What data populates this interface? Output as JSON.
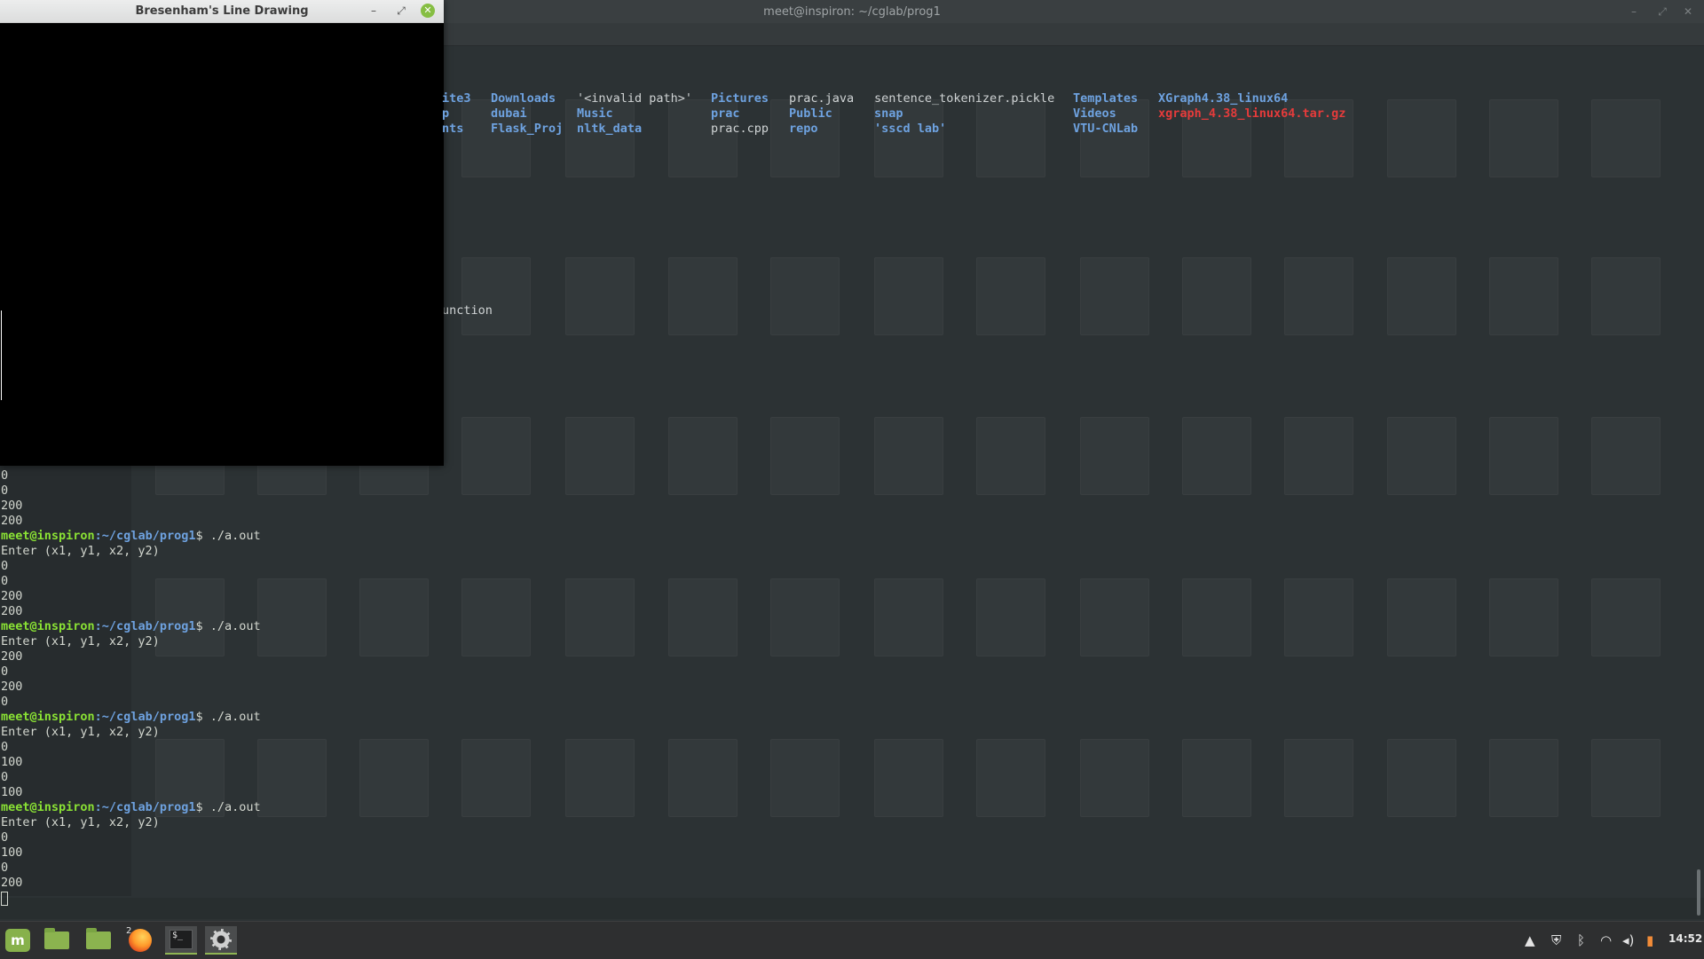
{
  "terminal": {
    "title": "meet@inspiron: ~/cglab/prog1",
    "ls_columns": [
      {
        "col": 1,
        "items": [
          {
            "text": "ite3",
            "kind": "dir"
          },
          {
            "text": "p",
            "kind": "dir"
          },
          {
            "text": "nts",
            "kind": "dir"
          }
        ]
      },
      {
        "col": 2,
        "items": [
          {
            "text": "Downloads",
            "kind": "dir"
          },
          {
            "text": "dubai",
            "kind": "dir"
          },
          {
            "text": "Flask_Proj",
            "kind": "dir"
          }
        ]
      },
      {
        "col": 3,
        "items": [
          {
            "text": "'<invalid path>'",
            "kind": "file"
          },
          {
            "text": "Music",
            "kind": "dir"
          },
          {
            "text": "nltk_data",
            "kind": "dir"
          }
        ]
      },
      {
        "col": 4,
        "items": [
          {
            "text": "Pictures",
            "kind": "dir"
          },
          {
            "text": "prac",
            "kind": "dir"
          },
          {
            "text": "prac.cpp",
            "kind": "file"
          }
        ]
      },
      {
        "col": 5,
        "items": [
          {
            "text": "prac.java",
            "kind": "file"
          },
          {
            "text": "Public",
            "kind": "dir"
          },
          {
            "text": "repo",
            "kind": "dir"
          }
        ]
      },
      {
        "col": 6,
        "items": [
          {
            "text": "sentence_tokenizer.pickle",
            "kind": "file"
          },
          {
            "text": "snap",
            "kind": "dir"
          },
          {
            "text": "'sscd lab'",
            "kind": "dir"
          }
        ]
      },
      {
        "col": 7,
        "items": [
          {
            "text": "Templates",
            "kind": "dir"
          },
          {
            "text": "Videos",
            "kind": "dir"
          },
          {
            "text": "VTU-CNLab",
            "kind": "dir"
          }
        ]
      },
      {
        "col": 8,
        "items": [
          {
            "text": "XGraph4.38_linux64",
            "kind": "dir"
          },
          {
            "text": "xgraph_4.38_linux64.tar.gz",
            "kind": "arch"
          }
        ]
      }
    ],
    "partial_line": "unction",
    "prompt_user": "meet@inspiron",
    "prompt_path": ":~/cglab/prog1",
    "prompt_cmd": "$ ./a.out",
    "enter_prompt": "Enter (x1, y1, x2, y2)",
    "leading_values": [
      "0",
      "0",
      "200",
      "200"
    ],
    "runs": [
      {
        "values": [
          "0",
          "0",
          "200",
          "200"
        ]
      },
      {
        "values": [
          "200",
          "0",
          "200",
          "0"
        ]
      },
      {
        "values": [
          "0",
          "100",
          "0",
          "100"
        ]
      },
      {
        "values": [
          "0",
          "100",
          "0",
          "200"
        ]
      }
    ]
  },
  "drawing_window": {
    "title": "Bresenham's Line Drawing",
    "controls": {
      "minimize": "–",
      "maximize": "⤢",
      "close": "✕"
    }
  },
  "taskbar": {
    "firefox_badge": "2",
    "terminal_icon_text": "$_",
    "clock": "14:52",
    "tray_icons": [
      "warning-icon",
      "shield-icon",
      "bluetooth-icon",
      "wifi-icon",
      "volume-icon",
      "battery-icon"
    ]
  }
}
